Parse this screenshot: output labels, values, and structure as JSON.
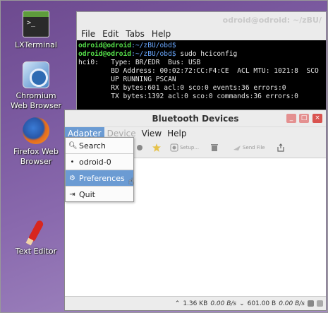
{
  "desktop": {
    "icons": [
      {
        "label": "LXTerminal",
        "icon": "terminal-icon"
      },
      {
        "label": "Chromium\nWeb Browser",
        "icon": "chromium-icon"
      },
      {
        "label": "Firefox Web\nBrowser",
        "icon": "firefox-icon"
      },
      {
        "label": "Text Editor",
        "icon": "text-editor-icon"
      }
    ]
  },
  "terminal": {
    "title": "odroid@odroid: ~/zBU/",
    "menu": [
      "File",
      "Edit",
      "Tabs",
      "Help"
    ],
    "lines": [
      {
        "user": "odroid@odroid",
        "path": ":~/zBU/obd$",
        "cmd": ""
      },
      {
        "user": "odroid@odroid",
        "path": ":~/zBU/obd$",
        "cmd": " sudo hciconfig"
      }
    ],
    "output": [
      "hci0:   Type: BR/EDR  Bus: USB",
      "        BD Address: 00:02:72:CC:F4:CE  ACL MTU: 1021:8  SCO",
      "        UP RUNNING PSCAN",
      "        RX bytes:601 acl:0 sco:0 events:36 errors:0",
      "        TX bytes:1392 acl:0 sco:0 commands:36 errors:0"
    ]
  },
  "bluetooth": {
    "title": "Bluetooth Devices",
    "menu": [
      {
        "label": "Adapter",
        "state": "active"
      },
      {
        "label": "Device",
        "state": "disabled"
      },
      {
        "label": "View",
        "state": "normal"
      },
      {
        "label": "Help",
        "state": "normal"
      }
    ],
    "toolbar": {
      "setup_label": "Setup...",
      "send_file_label": "Send File"
    },
    "status": {
      "upload": "1.36 KB",
      "upload_rate": "0.00 B/s",
      "download": "601.00 B",
      "download_rate": "0.00 B/s"
    }
  },
  "adapter_menu": {
    "items": [
      {
        "label": "Search",
        "icon": "search-icon",
        "highlighted": false
      },
      {
        "label": "odroid-0",
        "icon": "bullet-icon",
        "highlighted": false
      },
      {
        "label": "Preferences",
        "icon": "gear-icon",
        "highlighted": true
      },
      {
        "label": "Quit",
        "icon": "exit-icon",
        "highlighted": false
      }
    ]
  },
  "colors": {
    "menu_highlight": "#6b9bd3",
    "terminal_user": "#55e04a",
    "terminal_path": "#6aa8ff"
  }
}
